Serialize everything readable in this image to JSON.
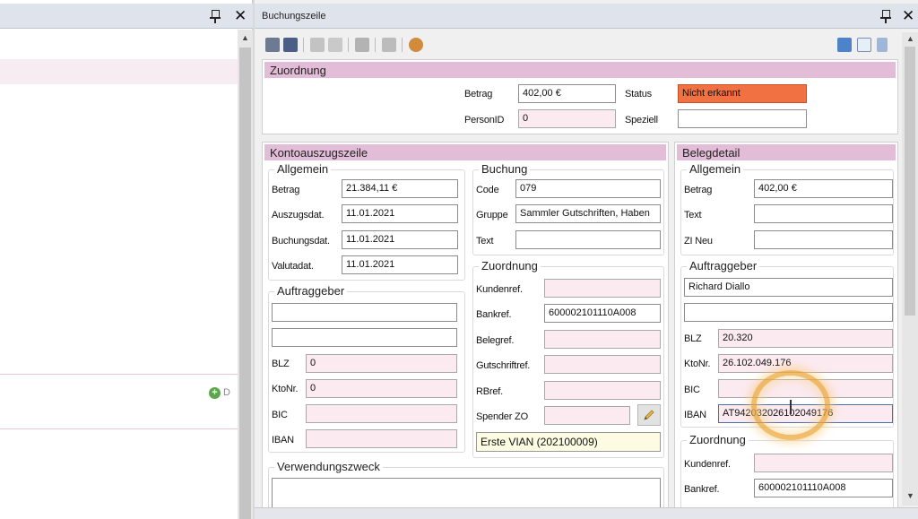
{
  "left_panel": {
    "add_label": "D"
  },
  "right_panel": {
    "title": "Buchungszeile"
  },
  "zuordnung_top": {
    "header": "Zuordnung",
    "betrag_label": "Betrag",
    "betrag_value": "402,00 €",
    "status_label": "Status",
    "status_value": "Nicht erkannt",
    "personid_label": "PersonID",
    "personid_value": "0",
    "speziell_label": "Speziell",
    "speziell_value": ""
  },
  "kontoauszug": {
    "header": "Kontoauszugszeile",
    "allgemein": {
      "legend": "Allgemein",
      "betrag_label": "Betrag",
      "betrag_value": "21.384,11 €",
      "auszugsdat_label": "Auszugsdat.",
      "auszugsdat_value": "11.01.2021",
      "buchungsdat_label": "Buchungsdat.",
      "buchungsdat_value": "11.01.2021",
      "valutadat_label": "Valutadat.",
      "valutadat_value": "11.01.2021"
    },
    "buchung": {
      "legend": "Buchung",
      "code_label": "Code",
      "code_value": "079",
      "gruppe_label": "Gruppe",
      "gruppe_value": "Sammler Gutschriften, Haben",
      "text_label": "Text",
      "text_value": ""
    },
    "auftraggeber": {
      "legend": "Auftraggeber",
      "name1_value": "",
      "name2_value": "",
      "blz_label": "BLZ",
      "blz_value": "0",
      "ktonr_label": "KtoNr.",
      "ktonr_value": "0",
      "bic_label": "BIC",
      "bic_value": "",
      "iban_label": "IBAN",
      "iban_value": ""
    },
    "zuordnung": {
      "legend": "Zuordnung",
      "kundenref_label": "Kundenref.",
      "kundenref_value": "",
      "bankref_label": "Bankref.",
      "bankref_value": "600002101110A008",
      "belegref_label": "Belegref.",
      "belegref_value": "",
      "gutschriftref_label": "Gutschriftref.",
      "gutschriftref_value": "",
      "rbref_label": "RBref.",
      "rbref_value": "",
      "spender_label": "Spender ZO",
      "spender_value": "",
      "vian_value": "Erste VIAN (202100009)"
    },
    "verwendungszweck": {
      "legend": "Verwendungszweck",
      "value": ""
    }
  },
  "belegdetail": {
    "header": "Belegdetail",
    "allgemein": {
      "legend": "Allgemein",
      "betrag_label": "Betrag",
      "betrag_value": "402,00 €",
      "text_label": "Text",
      "text_value": "",
      "zineu_label": "ZI Neu",
      "zineu_value": ""
    },
    "auftraggeber": {
      "legend": "Auftraggeber",
      "name1_value": "Richard Diallo",
      "name2_value": "",
      "blz_label": "BLZ",
      "blz_value": "20.320",
      "ktonr_label": "KtoNr.",
      "ktonr_value": "26.102.049.176",
      "bic_label": "BIC",
      "bic_value": "",
      "iban_label": "IBAN",
      "iban_value": "AT942032026102049176"
    },
    "zuordnung": {
      "legend": "Zuordnung",
      "kundenref_label": "Kundenref.",
      "kundenref_value": "",
      "bankref_label": "Bankref.",
      "bankref_value": "600002101110A008"
    }
  },
  "colors": {
    "section_header": "#e3bcd8",
    "status_unrecognized": "#f27142",
    "pink_field": "#fbeaf0"
  }
}
